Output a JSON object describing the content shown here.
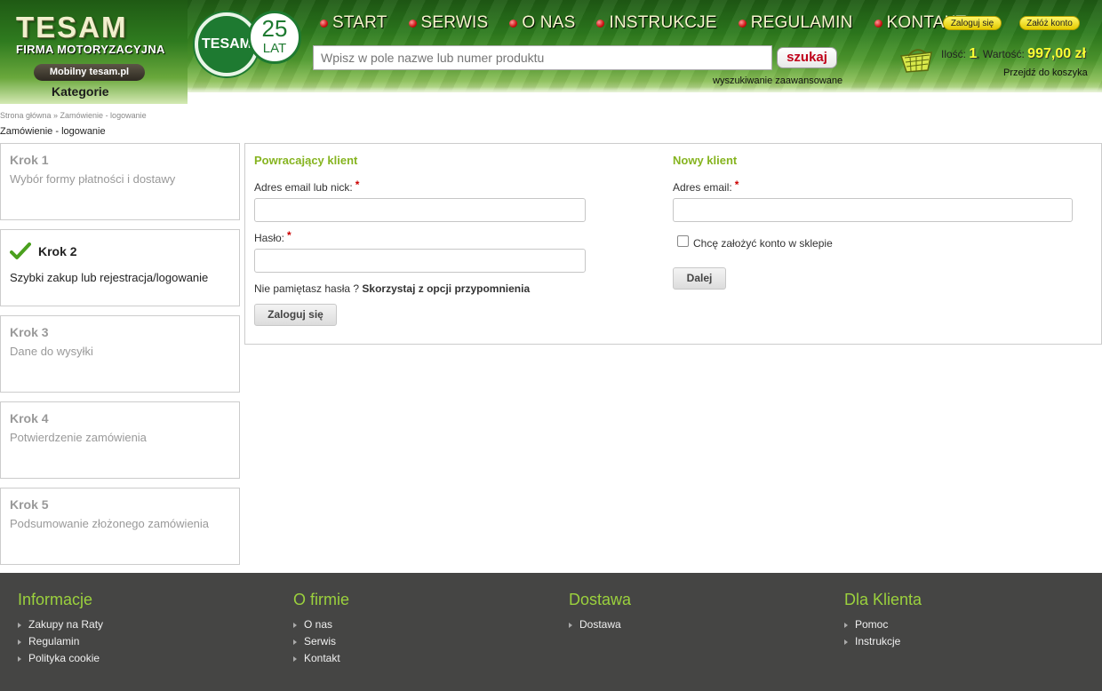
{
  "header": {
    "logo_title": "TESAM",
    "logo_subtitle": "FIRMA MOTORYZACYJNA",
    "mobile_link": "Mobilny tesam.pl",
    "categories_label": "Kategorie",
    "badge_brand": "TESAM",
    "badge_years": "25",
    "badge_years_label": "LAT",
    "nav": [
      "START",
      "SERWIS",
      "O NAS",
      "INSTRUKCJE",
      "REGULAMIN",
      "KONTAKT"
    ],
    "search_placeholder": "Wpisz w pole nazwe lub numer produktu",
    "search_button": "szukaj",
    "advanced_search": "wyszukiwanie zaawansowane",
    "login_button": "Zaloguj się",
    "register_button": "Załóż konto",
    "cart": {
      "qty_label": "Ilość:",
      "qty_value": "1",
      "value_label": ", Wartość:",
      "value": "997,00 zł",
      "go_to_cart": "Przejdź do koszyka"
    }
  },
  "breadcrumb": "Strona główna » Zamówienie - logowanie",
  "page_title": "Zamówienie - logowanie",
  "steps": [
    {
      "title": "Krok 1",
      "desc": "Wybór formy płatności i dostawy"
    },
    {
      "title": "Krok 2",
      "desc": "Szybki zakup lub rejestracja/logowanie"
    },
    {
      "title": "Krok 3",
      "desc": "Dane do wysyłki"
    },
    {
      "title": "Krok 4",
      "desc": "Potwierdzenie zamówienia"
    },
    {
      "title": "Krok 5",
      "desc": "Podsumowanie złożonego zamówienia"
    }
  ],
  "returning": {
    "title": "Powracający klient",
    "email_label": "Adres email lub nick:",
    "password_label": "Hasło:",
    "forgot_text": "Nie pamiętasz hasła ?",
    "forgot_link": "Skorzystaj z opcji przypomnienia",
    "login_button": "Zaloguj się"
  },
  "new_client": {
    "title": "Nowy klient",
    "email_label": "Adres email:",
    "create_account_label": "Chcę założyć konto w sklepie",
    "next_button": "Dalej"
  },
  "required_mark": "*",
  "footer": [
    {
      "title": "Informacje",
      "links": [
        "Zakupy na Raty",
        "Regulamin",
        "Polityka cookie"
      ]
    },
    {
      "title": "O firmie",
      "links": [
        "O nas",
        "Serwis",
        "Kontakt"
      ]
    },
    {
      "title": "Dostawa",
      "links": [
        "Dostawa"
      ]
    },
    {
      "title": "Dla Klienta",
      "links": [
        "Pomoc",
        "Instrukcje"
      ]
    }
  ]
}
